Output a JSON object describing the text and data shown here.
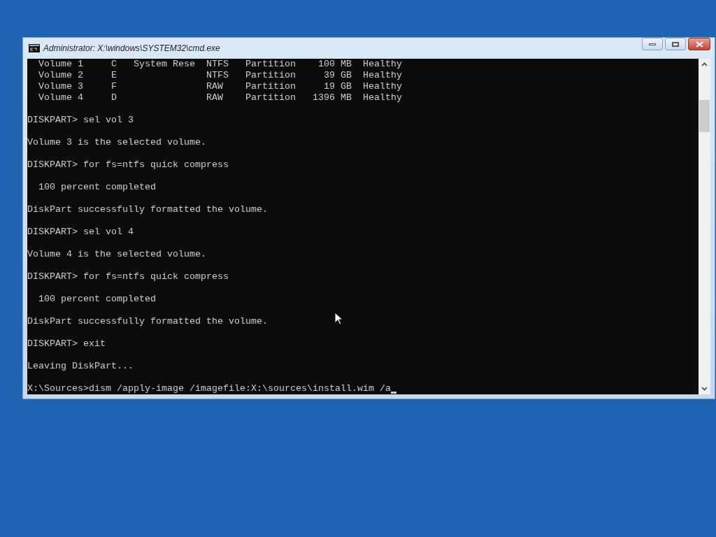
{
  "window": {
    "title": "Administrator: X:\\windows\\SYSTEM32\\cmd.exe"
  },
  "console": {
    "blocks": [
      [
        "  Volume 1     C   System Rese  NTFS   Partition    100 MB  Healthy",
        "  Volume 2     E                NTFS   Partition     39 GB  Healthy",
        "  Volume 3     F                RAW    Partition     19 GB  Healthy",
        "  Volume 4     D                RAW    Partition   1396 MB  Healthy"
      ],
      [
        "DISKPART> sel vol 3"
      ],
      [
        "Volume 3 is the selected volume."
      ],
      [
        "DISKPART> for fs=ntfs quick compress"
      ],
      [
        "  100 percent completed"
      ],
      [
        "DiskPart successfully formatted the volume."
      ],
      [
        "DISKPART> sel vol 4"
      ],
      [
        "Volume 4 is the selected volume."
      ],
      [
        "DISKPART> for fs=ntfs quick compress"
      ],
      [
        "  100 percent completed"
      ],
      [
        "DiskPart successfully formatted the volume."
      ],
      [
        "DISKPART> exit"
      ],
      [
        "Leaving DiskPart..."
      ],
      [
        "X:\\Sources>dism /apply-image /imagefile:X:\\sources\\install.wim /a"
      ]
    ]
  }
}
